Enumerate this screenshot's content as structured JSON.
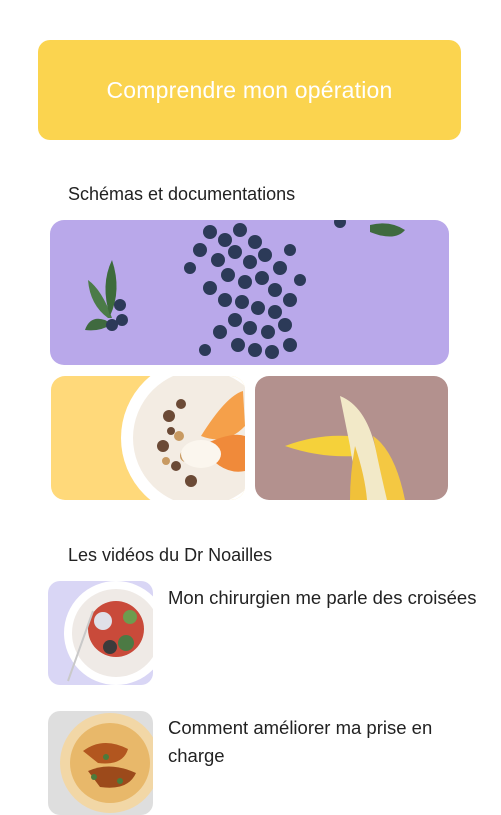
{
  "hero": {
    "label": "Comprendre mon opération"
  },
  "docs": {
    "title": "Schémas et documentations",
    "cards": [
      {
        "image": "blueberries-on-purple"
      },
      {
        "image": "granola-bowl-with-peaches"
      },
      {
        "image": "peeled-banana-on-mauve"
      }
    ]
  },
  "videos": {
    "title": "Les vidéos du Dr Noailles",
    "items": [
      {
        "title": "Mon chirurgien me parle des croisées",
        "thumb": "salad-plate"
      },
      {
        "title": "Comment améliorer ma prise en charge",
        "thumb": "roasted-chicken-plate"
      }
    ]
  },
  "colors": {
    "accent": "#fbd44f",
    "purple": "#b9a8ea",
    "yellow_bg": "#ffd97a",
    "mauve_bg": "#b3918e"
  }
}
